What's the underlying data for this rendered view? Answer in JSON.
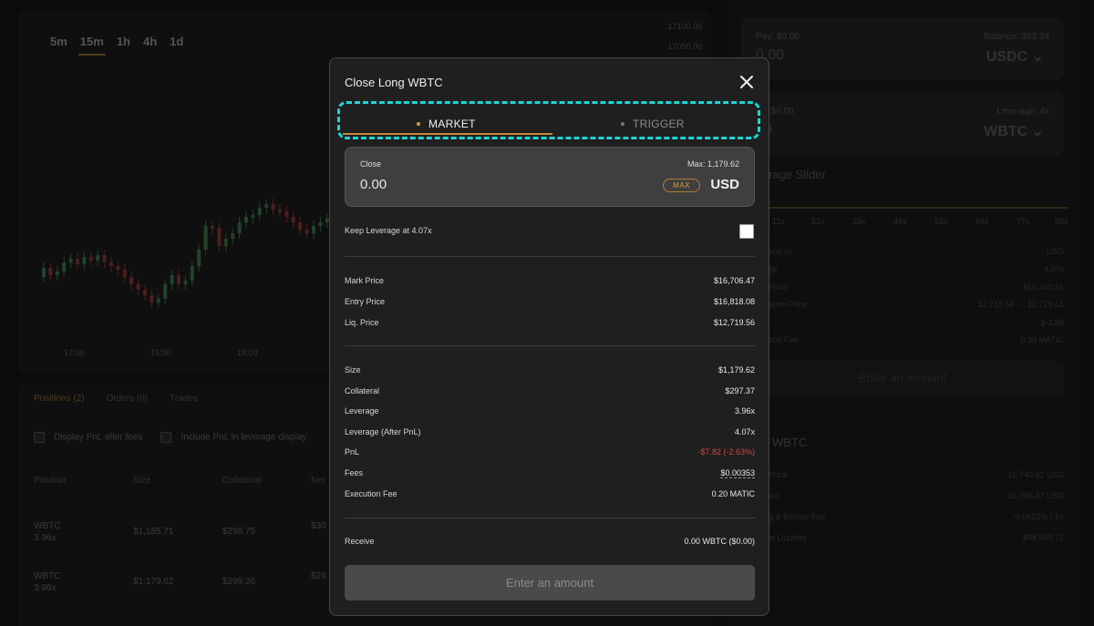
{
  "background": {
    "timeframes": [
      "5m",
      "15m",
      "1h",
      "4h",
      "1d"
    ],
    "price_axis": [
      "17100.00",
      "17050.00"
    ],
    "time_axis": [
      "12:00",
      "15:00",
      "18:00"
    ],
    "positions_tabs": [
      "Positions (2)",
      "Orders (0)",
      "Trades"
    ],
    "checkbox_labels": [
      "Display PnL after fees",
      "Include PnL in leverage display"
    ],
    "table_headers": [
      "Position",
      "Size",
      "Collateral",
      "Net"
    ],
    "rows": [
      {
        "market": "WBTC",
        "sub": "3.96x",
        "size": "$1,185.71",
        "collateral": "$298.75",
        "net": "$30"
      },
      {
        "market": "WBTC",
        "sub": "3.96x",
        "size": "$1,179.62",
        "collateral": "$299.26",
        "net": "$29"
      }
    ],
    "side": {
      "pay_label": "Pay: $0.00",
      "balance_label": "Balance: 383.94",
      "pay_value": "0.00",
      "pay_token": "USDC",
      "long_label": "ng: $0.00",
      "leverage_label": "Leverage: 4x",
      "long_value": "00",
      "long_token": "WBTC",
      "slider_title": "rage Slider",
      "slider_ticks": [
        "1x",
        "11x",
        "22x",
        "33x",
        "44x",
        "55x",
        "66x",
        "77x",
        "88x"
      ],
      "info": [
        {
          "k": "eral In",
          "v": "USD"
        },
        {
          "k": "ge",
          "v": "4.07x"
        },
        {
          "k": "Price",
          "v": "$16,740.91"
        },
        {
          "k": "ation Price",
          "v": "12,719.56 → 12,719.61"
        },
        {
          "k": "",
          "v": "$-1.88"
        },
        {
          "k": "tion Fee",
          "v": "0.20 MATIC"
        }
      ],
      "button": "Enter an amount",
      "wbtc_title": "WBTC",
      "info2": [
        {
          "k": "Price",
          "v": "16,740.91 USD"
        },
        {
          "k": "ice",
          "v": "16,706.47 USD"
        },
        {
          "k": "g & Borrow Fee",
          "v": "-0.0522% / 1h"
        },
        {
          "k": "le Liquidity",
          "v": "$98,599.71"
        }
      ]
    }
  },
  "modal": {
    "title": "Close Long WBTC",
    "tabs": {
      "market": "MARKET",
      "trigger": "TRIGGER"
    },
    "input": {
      "label": "Close",
      "max_label": "Max: 1,179.62",
      "value": "0.00",
      "max_button": "MAX",
      "unit": "USD"
    },
    "keep_leverage_label": "Keep Leverage at 4.07x",
    "prices": [
      {
        "label": "Mark Price",
        "value": "$16,706.47"
      },
      {
        "label": "Entry Price",
        "value": "$16,818.08"
      },
      {
        "label": "Liq. Price",
        "value": "$12,719.56"
      }
    ],
    "details": [
      {
        "label": "Size",
        "value": "$1,179.62"
      },
      {
        "label": "Collateral",
        "value": "$297.37"
      },
      {
        "label": "Leverage",
        "value": "3.96x"
      },
      {
        "label": "Leverage (After PnL)",
        "value": "4.07x"
      },
      {
        "label": "PnL",
        "value": "-$7.82 (-2.63%)"
      },
      {
        "label": "Fees",
        "value": "$0.00353"
      },
      {
        "label": "Execution Fee",
        "value": "0.20 MATIC"
      }
    ],
    "receive": {
      "label": "Receive",
      "value": "0.00 WBTC ($0.00)"
    },
    "submit": "Enter an amount"
  },
  "colors": {
    "accent": "#c4893a",
    "negative": "#d94444",
    "highlight": "#1ed6d6"
  }
}
